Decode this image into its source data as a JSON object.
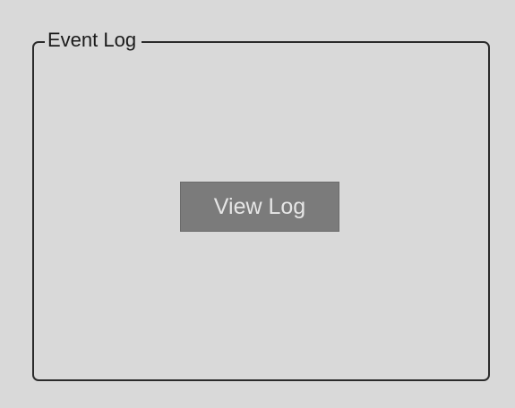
{
  "group": {
    "title": "Event Log"
  },
  "buttons": {
    "view_log_label": "View Log"
  },
  "colors": {
    "background": "#d9d9d9",
    "border": "#2b2b2b",
    "button_bg": "#7b7b7b",
    "button_text": "#e6e6e6"
  }
}
